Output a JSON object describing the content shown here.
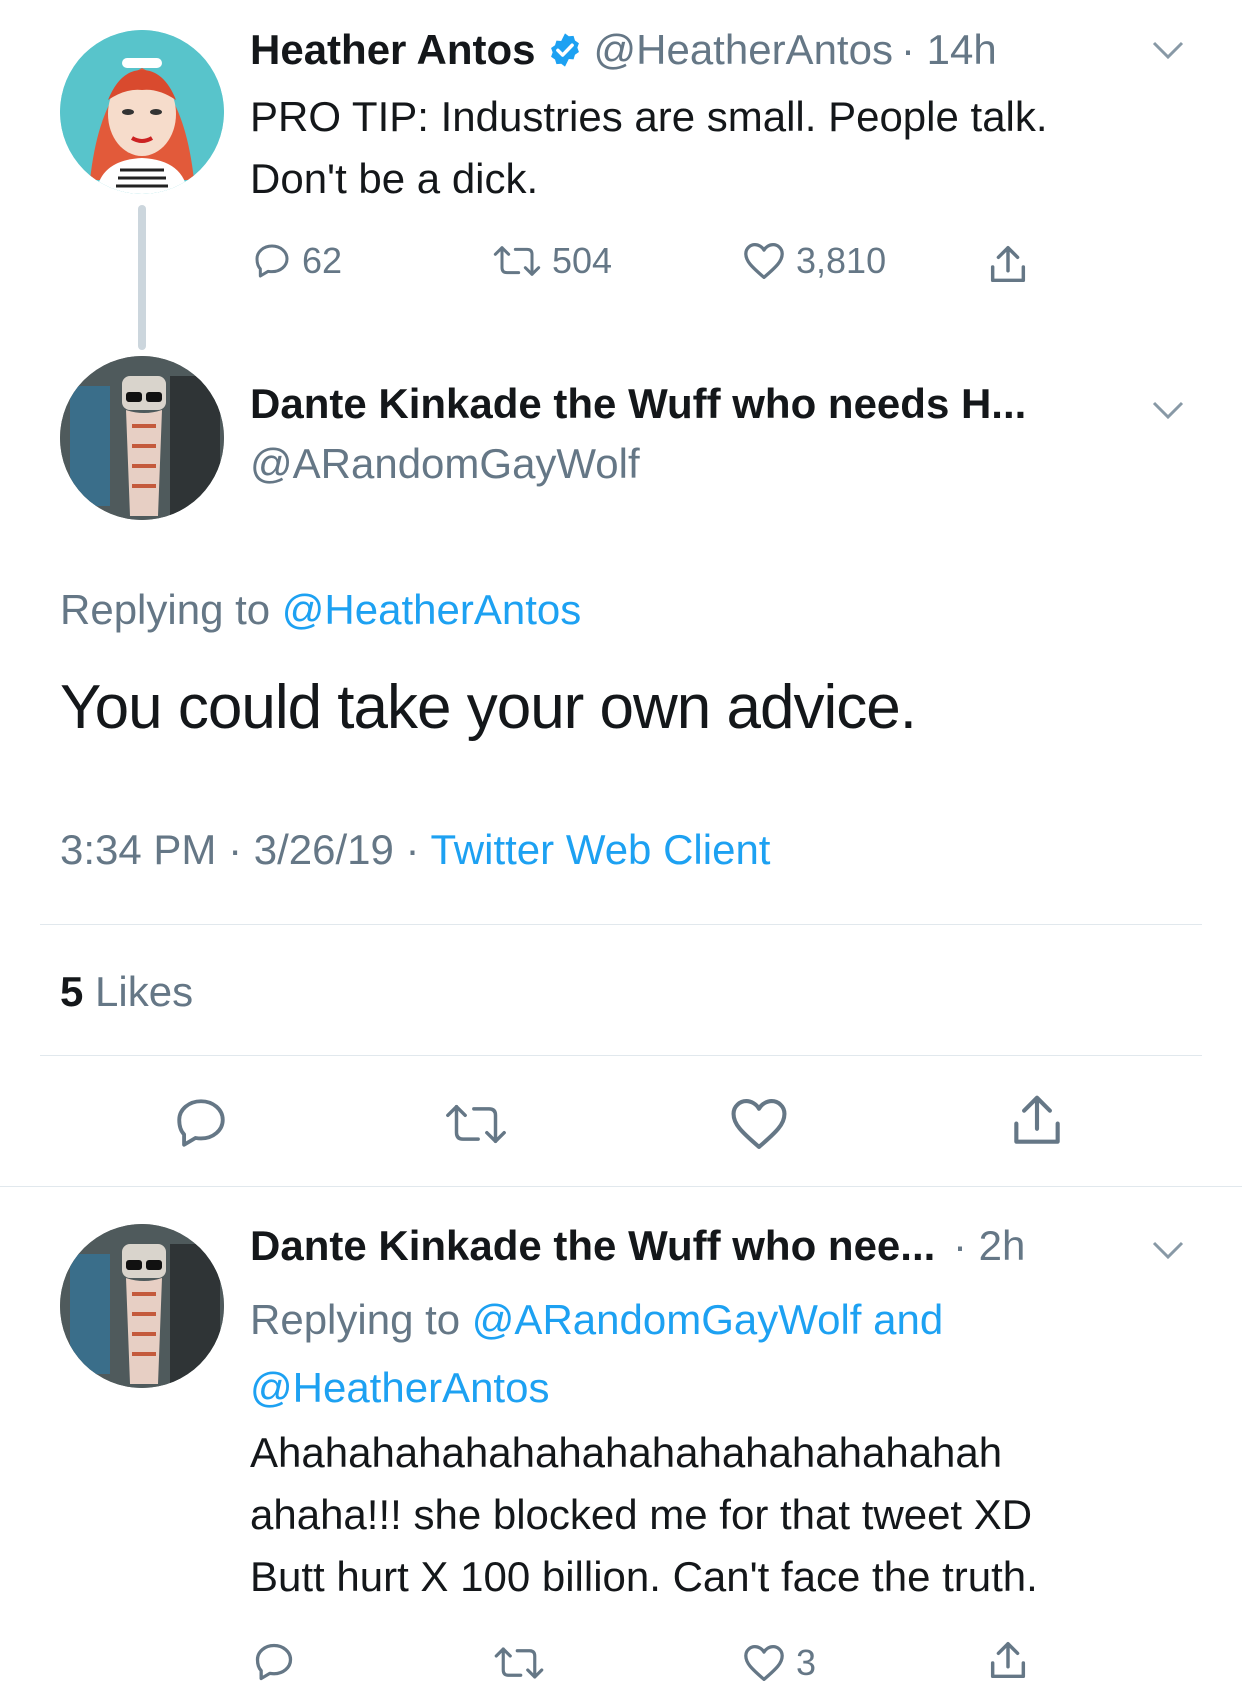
{
  "tweet1": {
    "name": "Heather Antos",
    "handle": "@HeatherAntos",
    "time": "· 14h",
    "text_line1": "PRO TIP: Industries are small. People talk.",
    "text_line2": "Don't be a dick.",
    "replies": "62",
    "retweets": "504",
    "likes": "3,810"
  },
  "tweet2": {
    "name": "Dante Kinkade the Wuff who needs H...",
    "handle": "@ARandomGayWolf",
    "replying_prefix": "Replying to",
    "replying_to": "@HeatherAntos",
    "text": "You could take your own advice.",
    "time": "3:34 PM",
    "date": "· 3/26/19 ·",
    "client": "Twitter Web Client",
    "likes_count": "5",
    "likes_label": "Likes"
  },
  "tweet3": {
    "name": "Dante Kinkade the Wuff who nee...",
    "time": "· 2h",
    "replying_prefix": "Replying to",
    "replying_to_line1": "@ARandomGayWolf and",
    "replying_to_line2": "@HeatherAntos",
    "text_line1": "Ahahahahahahahahahahahahahahahah",
    "text_line2": "ahaha!!! she blocked me for that tweet XD",
    "text_line3": "Butt hurt X 100 billion. Can't face the truth.",
    "likes": "3"
  },
  "colors": {
    "accent": "#1da1f2",
    "muted": "#657786",
    "text": "#14171a",
    "divider": "#e1e8ed",
    "verified": "#1da1f2"
  }
}
